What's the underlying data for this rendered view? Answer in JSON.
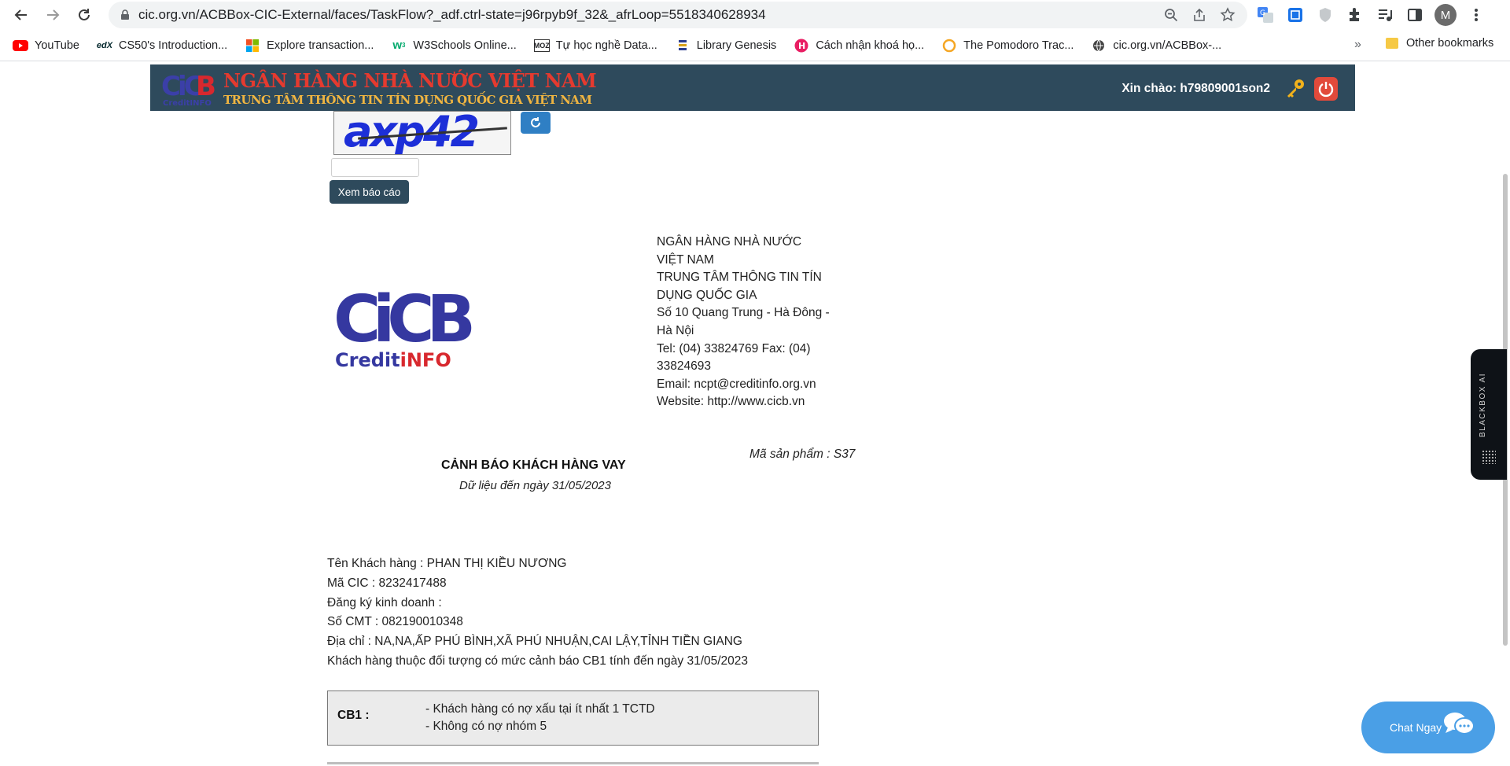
{
  "browser": {
    "url": "cic.org.vn/ACBBox-CIC-External/faces/TaskFlow?_adf.ctrl-state=j96rpyb9f_32&_afrLoop=5518340628934",
    "avatar_letter": "M",
    "bookmarks": [
      {
        "label": "YouTube",
        "icon": "youtube-icon",
        "color": "#ff0000"
      },
      {
        "label": "CS50's Introduction...",
        "icon": "edx-icon",
        "color": "#02262b"
      },
      {
        "label": "Explore transaction...",
        "icon": "microsoft-icon",
        "color": "#f25022"
      },
      {
        "label": "W3Schools Online...",
        "icon": "w3schools-icon",
        "color": "#04aa6d"
      },
      {
        "label": "Tự học nghề Data...",
        "icon": "moz-icon",
        "color": "#333333"
      },
      {
        "label": "Library Genesis",
        "icon": "libgen-icon",
        "color": "#2c3e8f"
      },
      {
        "label": "Cách nhận khoá họ...",
        "icon": "h-icon",
        "color": "#e91e63"
      },
      {
        "label": "The Pomodoro Trac...",
        "icon": "pomodoro-icon",
        "color": "#f5a623"
      },
      {
        "label": "cic.org.vn/ACBBox-...",
        "icon": "globe-icon",
        "color": "#444444"
      }
    ],
    "more_label": "»",
    "other_bookmarks": "Other bookmarks"
  },
  "header": {
    "title_line1": "NGÂN HÀNG NHÀ NƯỚC VIỆT NAM",
    "title_line2": "TRUNG TÂM THÔNG TIN TÍN DỤNG QUỐC GIA VIỆT NAM",
    "greeting": "Xin chào: h79809001son2",
    "logo_sub": "CreditINFO"
  },
  "captcha": {
    "text": "axp42",
    "input_value": "",
    "submit_label": "Xem báo cáo"
  },
  "report": {
    "logo_main": "CiCB",
    "logo_sub_a": "Credit",
    "logo_sub_b": "iNFO",
    "org_lines": [
      "NGÂN HÀNG NHÀ NƯỚC VIỆT NAM",
      "TRUNG TÂM THÔNG TIN TÍN DỤNG QUỐC GIA",
      "Số 10 Quang Trung - Hà Đông - Hà Nội",
      "Tel: (04) 33824769 Fax: (04) 33824693",
      "Email: ncpt@creditinfo.org.vn",
      "Website: http://www.cicb.vn"
    ],
    "product_code": "Mã sản phẩm : S37",
    "title": "CẢNH BÁO KHÁCH HÀNG VAY",
    "date_note": "Dữ liệu đến ngày 31/05/2023"
  },
  "customer": {
    "name": "Tên Khách hàng : PHAN THỊ KIỀU NƯƠNG",
    "cic": "Mã CIC : 8232417488",
    "business": "Đăng ký kinh doanh :",
    "id_no": "Số CMT : 082190010348",
    "address": "Địa chỉ : NA,NA,ẤP PHÚ BÌNH,XÃ PHÚ NHUẬN,CAI LẬY,TỈNH TIỀN GIANG",
    "warning": "Khách hàng thuộc đối tượng có mức cảnh báo CB1 tính đến ngày 31/05/2023"
  },
  "cb": {
    "label": "CB1 :",
    "line1": "- Khách hàng có nợ xấu tại ít nhất 1 TCTD",
    "line2": "- Không có nợ nhóm 5"
  },
  "widgets": {
    "blackbox_label": "BLACKBOX AI",
    "chat_label": "Chat Ngay"
  },
  "colors": {
    "header_bg": "#2e4a5c",
    "header_title": "#e53a2f",
    "header_subtitle": "#f0b541",
    "chat_bg": "#4a9fe6"
  }
}
